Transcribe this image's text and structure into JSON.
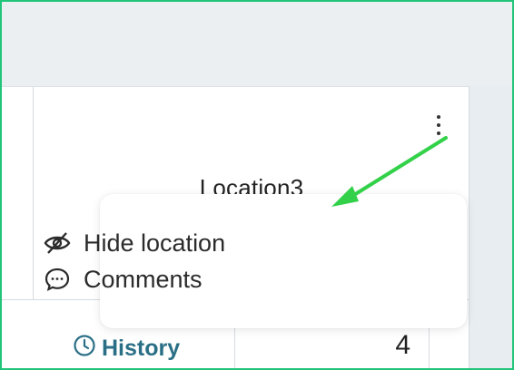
{
  "column": {
    "title": "Location3",
    "more_menu_icon": "vertical-dots-icon"
  },
  "context_menu": {
    "items": [
      {
        "label": "Hide location",
        "icon": "eye-off-icon"
      },
      {
        "label": "Comments",
        "icon": "comment-bubble-icon"
      }
    ]
  },
  "row": {
    "history_label": "History",
    "history_icon": "clock-icon",
    "count": "4"
  },
  "colors": {
    "frame_border": "#22c47a",
    "annotation_arrow": "#33d14a",
    "history_text": "#2a6f86"
  }
}
